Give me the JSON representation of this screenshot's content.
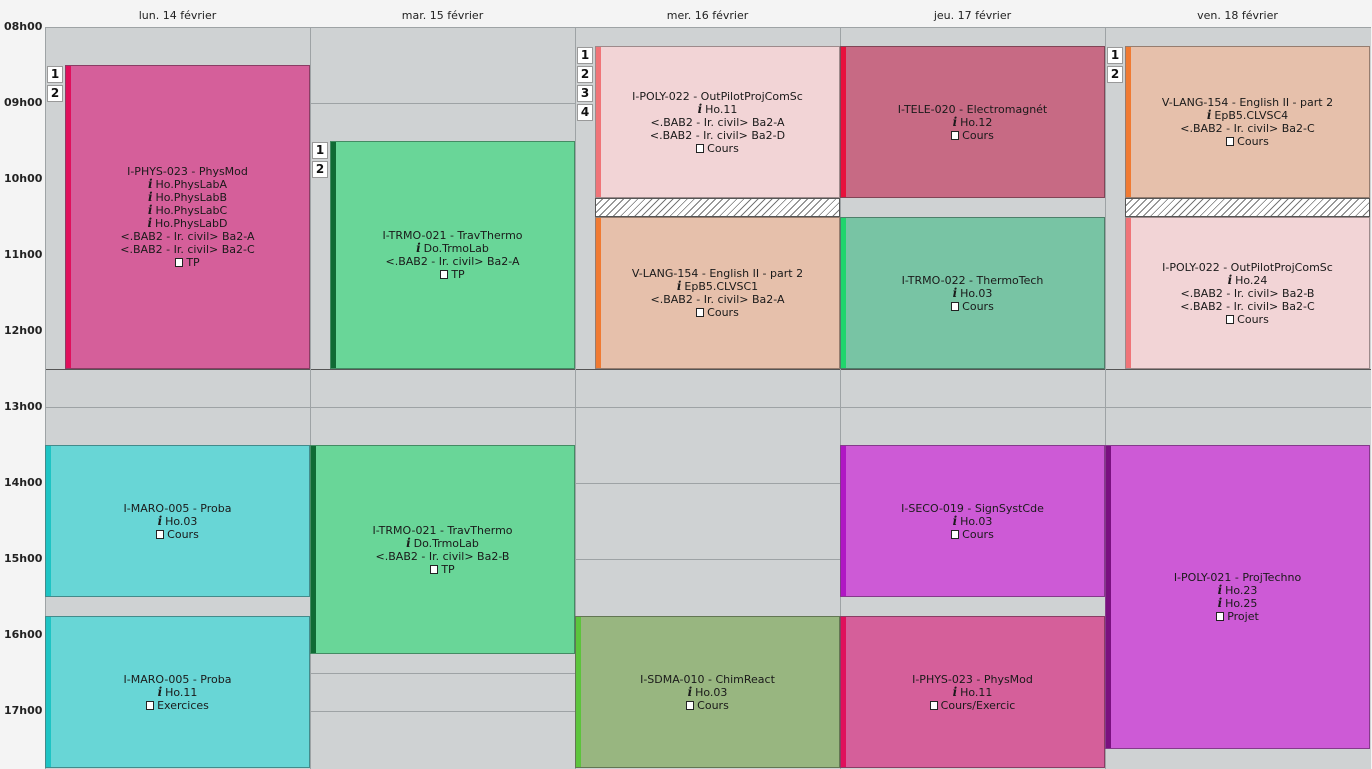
{
  "days": [
    "lun. 14 février",
    "mar. 15 février",
    "mer. 16 février",
    "jeu. 17 février",
    "ven. 18 février"
  ],
  "hours": [
    "08h00",
    "09h00",
    "10h00",
    "11h00",
    "12h00",
    "13h00",
    "14h00",
    "15h00",
    "16h00",
    "17h00"
  ],
  "events": [
    {
      "title": "I-PHYS-023 - PhysMod",
      "rooms": [
        "Ho.PhysLabA",
        "Ho.PhysLabB",
        "Ho.PhysLabC",
        "Ho.PhysLabD"
      ],
      "groups": [
        "<.BAB2 - Ir. civil> Ba2-A",
        "<.BAB2 - Ir. civil> Ba2-C"
      ],
      "type": "TP",
      "group_numbers": [
        "1",
        "2"
      ],
      "color": "#d55f9a",
      "bar_color": "#e0105c"
    },
    {
      "title": "I-TRMO-021 - TravThermo",
      "rooms": [
        "Do.TrmoLab"
      ],
      "groups": [
        "<.BAB2 - Ir. civil> Ba2-A"
      ],
      "type": "TP",
      "group_numbers": [
        "1",
        "2"
      ],
      "color": "#69d698",
      "bar_color": "#0f6b34"
    },
    {
      "title": "I-POLY-022 - OutPilotProjComSc",
      "rooms": [
        "Ho.11"
      ],
      "groups": [
        "<.BAB2 - Ir. civil> Ba2-A",
        "<.BAB2 - Ir. civil> Ba2-D"
      ],
      "type": "Cours",
      "group_numbers": [
        "1",
        "2",
        "3",
        "4"
      ],
      "color": "#f2d4d6",
      "bar_color": "#f07478"
    },
    {
      "title": "V-LANG-154 - English II - part 2",
      "rooms": [
        "EpB5.CLVSC1"
      ],
      "groups": [
        "<.BAB2 - Ir. civil> Ba2-A"
      ],
      "type": "Cours",
      "group_numbers": [],
      "color": "#e6c0ab",
      "bar_color": "#f07a32"
    },
    {
      "title": "I-TELE-020 - Electromagnét",
      "rooms": [
        "Ho.12"
      ],
      "groups": [],
      "type": "Cours",
      "group_numbers": [],
      "color": "#c76a84",
      "bar_color": "#e8103c"
    },
    {
      "title": "I-TRMO-022 - ThermoTech",
      "rooms": [
        "Ho.03"
      ],
      "groups": [],
      "type": "Cours",
      "group_numbers": [],
      "color": "#78c4a4",
      "bar_color": "#1fd66c"
    },
    {
      "title": "V-LANG-154 - English II - part 2",
      "rooms": [
        "EpB5.CLVSC4"
      ],
      "groups": [
        "<.BAB2 - Ir. civil> Ba2-C"
      ],
      "type": "Cours",
      "group_numbers": [
        "1",
        "2"
      ],
      "color": "#e6c0ab",
      "bar_color": "#f07a32"
    },
    {
      "title": "I-POLY-022 - OutPilotProjComSc",
      "rooms": [
        "Ho.24"
      ],
      "groups": [
        "<.BAB2 - Ir. civil> Ba2-B",
        "<.BAB2 - Ir. civil> Ba2-C"
      ],
      "type": "Cours",
      "group_numbers": [],
      "color": "#f2d4d6",
      "bar_color": "#f07478"
    },
    {
      "title": "I-MARO-005 - Proba",
      "rooms": [
        "Ho.03"
      ],
      "groups": [],
      "type": "Cours",
      "group_numbers": [],
      "color": "#68d6d6",
      "bar_color": "#1ec4c4"
    },
    {
      "title": "I-MARO-005 - Proba",
      "rooms": [
        "Ho.11"
      ],
      "groups": [],
      "type": "Exercices",
      "group_numbers": [],
      "color": "#68d6d6",
      "bar_color": "#1ec4c4"
    },
    {
      "title": "I-TRMO-021 - TravThermo",
      "rooms": [
        "Do.TrmoLab"
      ],
      "groups": [
        "<.BAB2 - Ir. civil> Ba2-B"
      ],
      "type": "TP",
      "group_numbers": [],
      "color": "#69d698",
      "bar_color": "#0f6b34"
    },
    {
      "title": "I-SDMA-010 - ChimReact",
      "rooms": [
        "Ho.03"
      ],
      "groups": [],
      "type": "Cours",
      "group_numbers": [],
      "color": "#98b680",
      "bar_color": "#5cc43c"
    },
    {
      "title": "I-SECO-019 - SignSystCde",
      "rooms": [
        "Ho.03"
      ],
      "groups": [],
      "type": "Cours",
      "group_numbers": [],
      "color": "#cd5ad6",
      "bar_color": "#b016c4"
    },
    {
      "title": "I-PHYS-023 - PhysMod",
      "rooms": [
        "Ho.11"
      ],
      "groups": [],
      "type": "Cours/Exercic",
      "group_numbers": [],
      "color": "#d55f9a",
      "bar_color": "#e0105c"
    },
    {
      "title": "I-POLY-021 - ProjTechno",
      "rooms": [
        "Ho.23",
        "Ho.25"
      ],
      "groups": [],
      "type": "Projet",
      "group_numbers": [],
      "color": "#cd5ad6",
      "bar_color": "#7a1080"
    }
  ]
}
